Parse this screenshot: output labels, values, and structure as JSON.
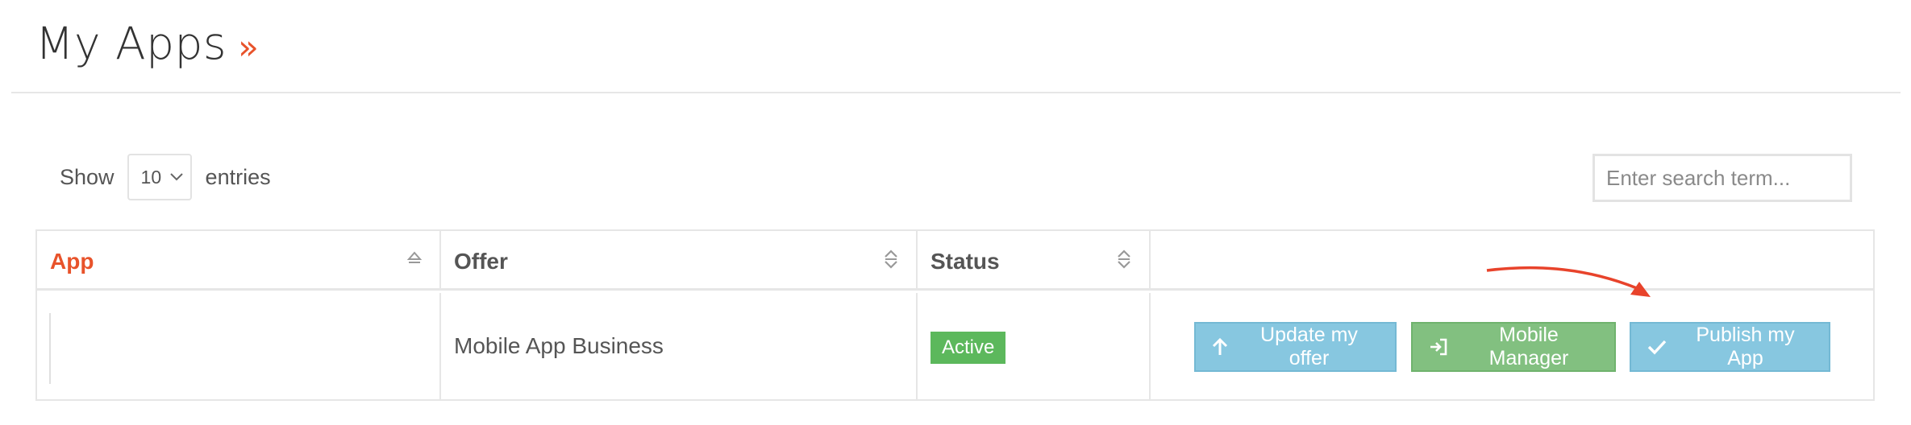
{
  "page": {
    "title": "My Apps",
    "title_suffix": "»"
  },
  "length_menu": {
    "prefix": "Show",
    "selected": "10",
    "suffix": "entries"
  },
  "search": {
    "placeholder": "Enter search term..."
  },
  "table": {
    "headers": [
      {
        "label": "App",
        "sort": "ascending"
      },
      {
        "label": "Offer",
        "sort": "none"
      },
      {
        "label": "Status",
        "sort": "none"
      },
      {
        "label": "",
        "sort": "disabled"
      }
    ],
    "rows": [
      {
        "app": "",
        "offer": "Mobile App Business",
        "status": "Active",
        "actions": [
          {
            "label": "Update my offer",
            "icon": "arrow-up-icon"
          },
          {
            "label": "Mobile Manager",
            "icon": "sign-in-icon"
          },
          {
            "label": "Publish my App",
            "icon": "check-icon"
          }
        ]
      }
    ]
  },
  "annotation": {
    "type": "arrow",
    "points_to": "Publish my App",
    "color": "#e8432b"
  },
  "colors": {
    "accent": "#e8532b",
    "info_button": "#87c7e0",
    "success_button": "#82c080",
    "status_active": "#5cb85c"
  }
}
